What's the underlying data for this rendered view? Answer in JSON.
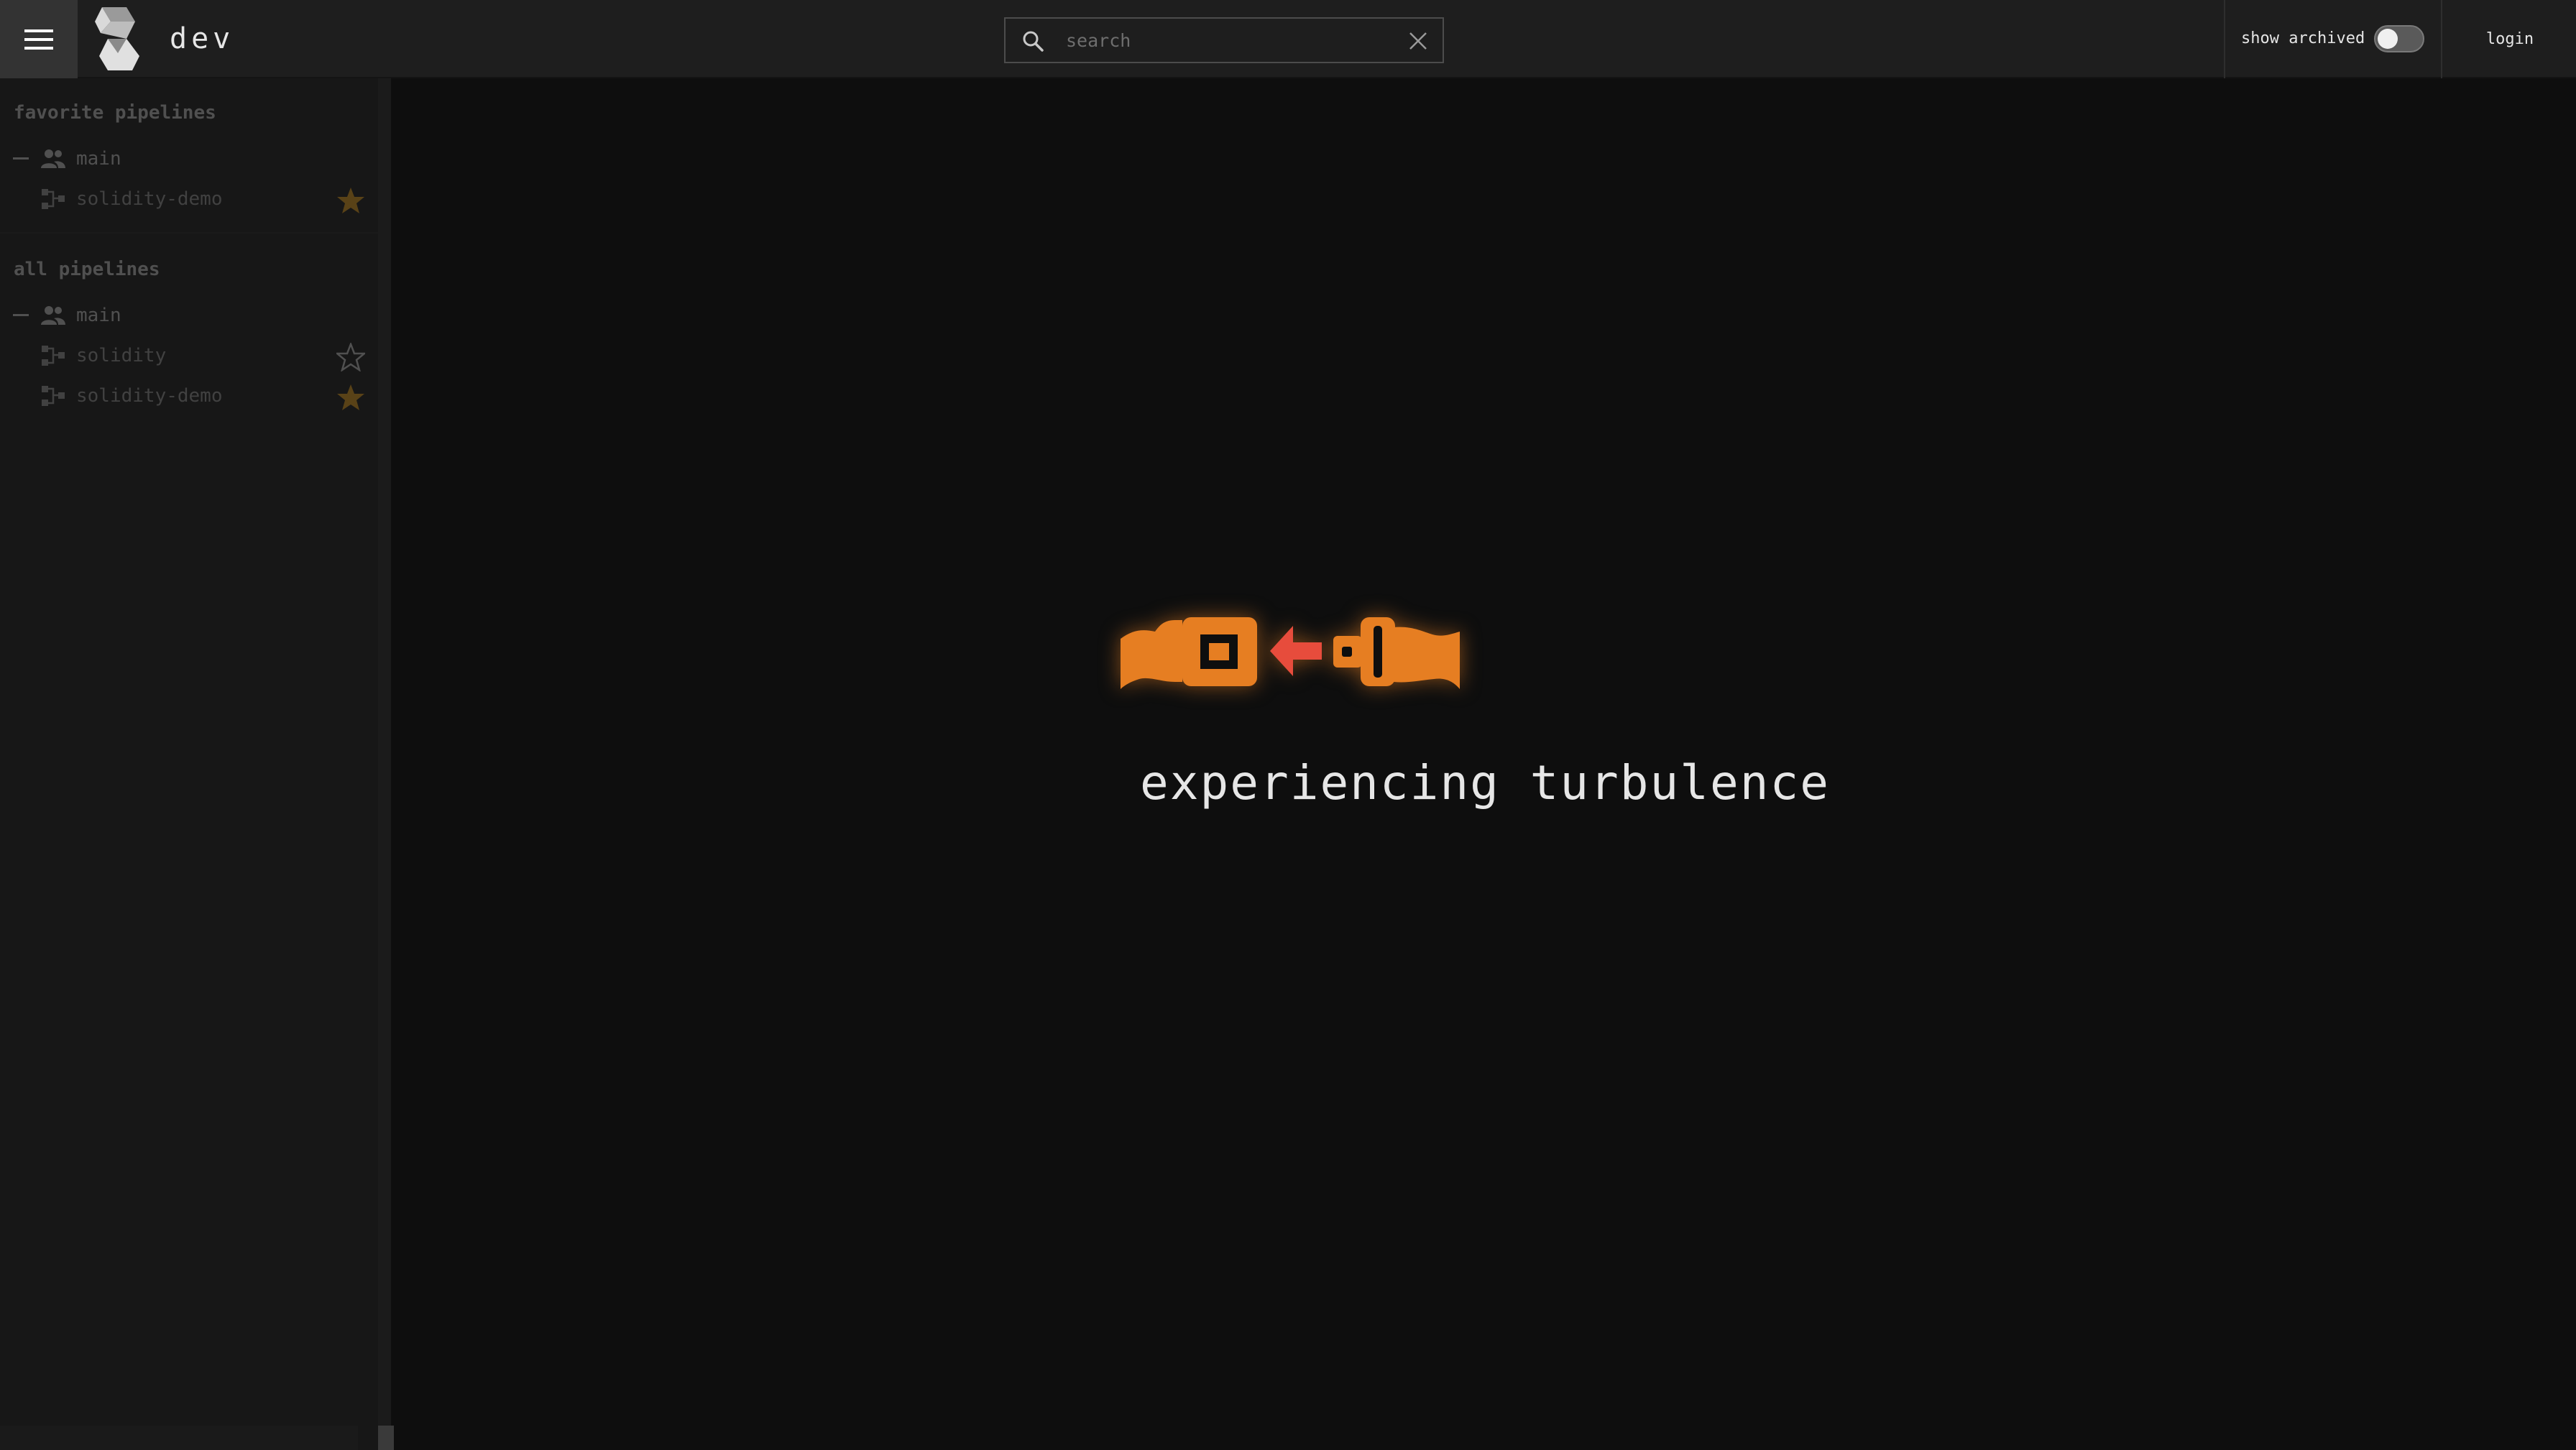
{
  "topbar": {
    "team_name": "dev",
    "search": {
      "placeholder": "search",
      "value": ""
    },
    "show_archived_label": "show archived",
    "show_archived_on": false,
    "login_label": "login"
  },
  "sidebar": {
    "favorites_title": "favorite pipelines",
    "favorites": [
      {
        "team": "main",
        "pipelines": [
          {
            "name": "solidity-demo",
            "favorited": true
          }
        ]
      }
    ],
    "all_title": "all pipelines",
    "all": [
      {
        "team": "main",
        "pipelines": [
          {
            "name": "solidity",
            "favorited": false
          },
          {
            "name": "solidity-demo",
            "favorited": true
          }
        ]
      }
    ]
  },
  "main": {
    "message": "experiencing turbulence"
  },
  "colors": {
    "accent_orange": "#e67e22",
    "arrow_red": "#e74c3c",
    "star_gold": "#e39c17"
  },
  "icons": {
    "menu": "hamburger-icon",
    "logo": "concourse-logo",
    "search": "search-icon",
    "clear": "close-icon",
    "team": "people-icon",
    "pipeline": "pipeline-icon",
    "star": "star-icon",
    "turbulence": "seatbelt-icon"
  }
}
